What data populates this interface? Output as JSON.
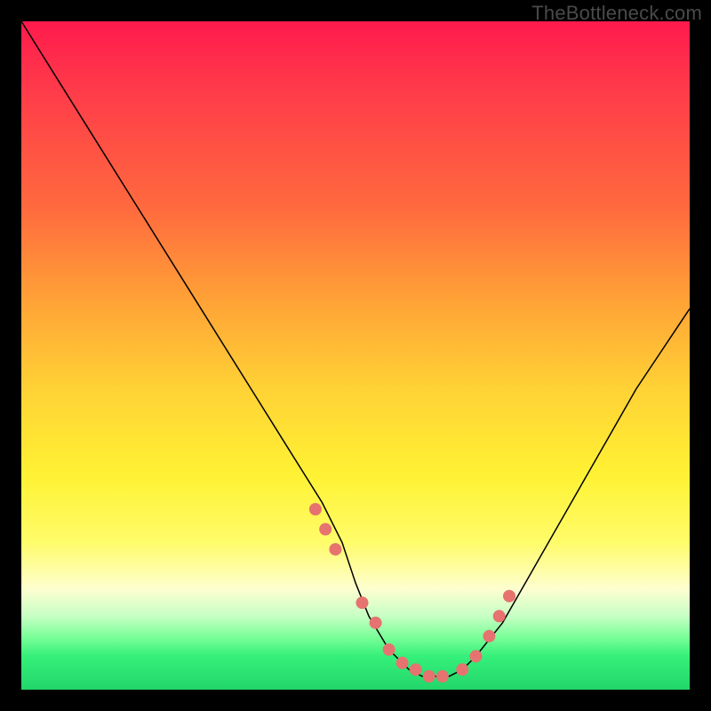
{
  "watermark": "TheBottleneck.com",
  "colors": {
    "dot": "#e6736f",
    "curve": "#000000"
  },
  "chart_data": {
    "type": "line",
    "title": "",
    "xlabel": "",
    "ylabel": "",
    "xlim": [
      0,
      100
    ],
    "ylim": [
      0,
      100
    ],
    "series": [
      {
        "name": "bottleneck-curve",
        "x": [
          0,
          5,
          10,
          15,
          20,
          25,
          30,
          35,
          40,
          45,
          48,
          50,
          52,
          55,
          58,
          60,
          62,
          64,
          66,
          68,
          72,
          76,
          80,
          84,
          88,
          92,
          96,
          100
        ],
        "y": [
          100,
          92,
          84,
          76,
          68,
          60,
          52,
          44,
          36,
          28,
          22,
          16,
          11,
          6,
          3,
          2,
          2,
          2,
          3,
          5,
          10,
          17,
          24,
          31,
          38,
          45,
          51,
          57
        ]
      }
    ],
    "markers": {
      "name": "highlight-dots",
      "x": [
        44,
        45.5,
        47,
        51,
        53,
        55,
        57,
        59,
        61,
        63,
        66,
        68,
        70,
        71.5,
        73
      ],
      "y": [
        27,
        24,
        21,
        13,
        10,
        6,
        4,
        3,
        2,
        2,
        3,
        5,
        8,
        11,
        14
      ]
    }
  }
}
